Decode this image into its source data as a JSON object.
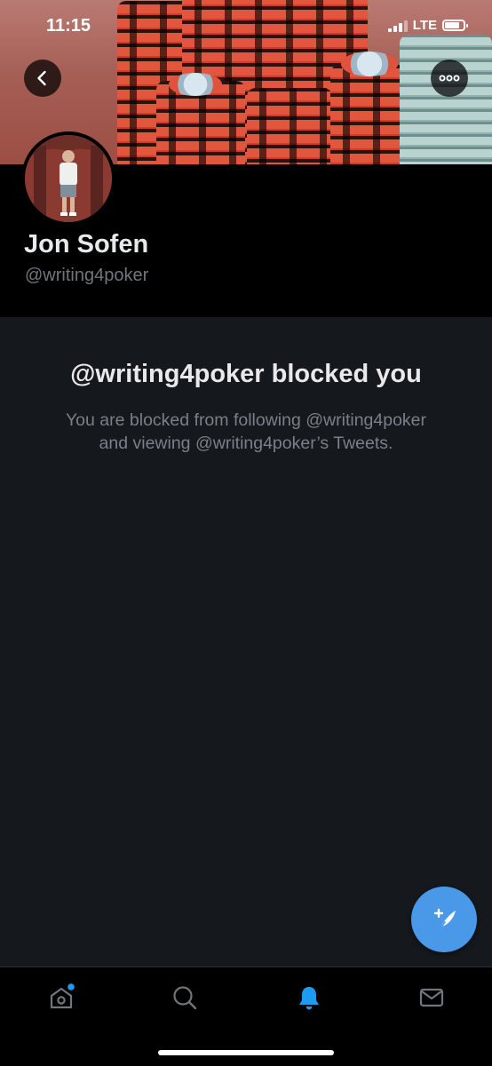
{
  "status_bar": {
    "time": "11:15",
    "network": "LTE"
  },
  "header": {
    "back_icon": "chevron-left-icon",
    "more_icon": "more-dots-icon"
  },
  "profile": {
    "display_name": "Jon Sofen",
    "handle": "@writing4poker"
  },
  "blocked_notice": {
    "title": "@writing4poker blocked you",
    "line1": "You are blocked from following @writing4poker",
    "line2": "and viewing @writing4poker’s Tweets."
  },
  "compose_button": {
    "icon": "compose-tweet-icon",
    "color": "#4a99e9"
  },
  "tab_bar": {
    "tabs": [
      {
        "name": "home",
        "icon": "home-icon",
        "has_dot": true
      },
      {
        "name": "search",
        "icon": "search-icon"
      },
      {
        "name": "notifications",
        "icon": "bell-icon",
        "active": true
      },
      {
        "name": "messages",
        "icon": "mail-icon"
      }
    ],
    "active_color": "#1d9bf0"
  },
  "colors": {
    "background": "#15181c",
    "accent": "#1d9bf0"
  }
}
